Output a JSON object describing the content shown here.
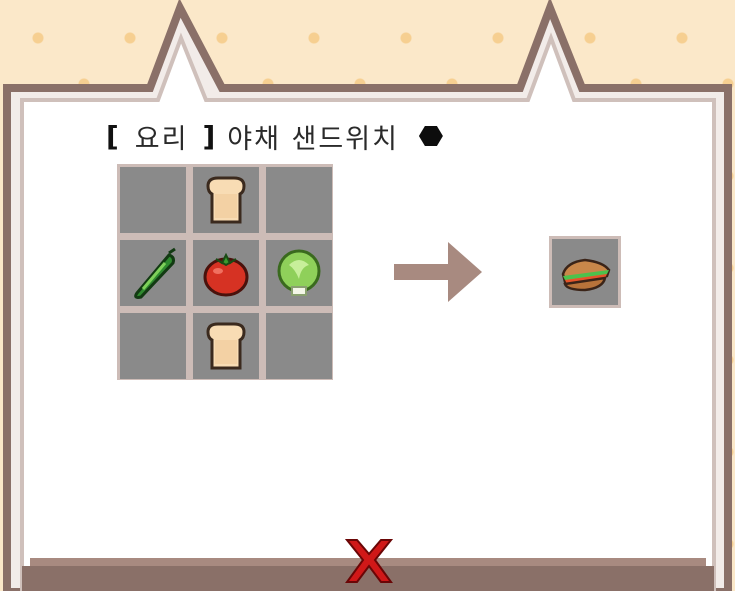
{
  "recipe": {
    "bracket_open": "[",
    "category": "요리",
    "bracket_close": "]",
    "name": "야채 샌드위치"
  },
  "ingredients": [
    {
      "slot": 1,
      "item": "empty"
    },
    {
      "slot": 2,
      "item": "bread-slice"
    },
    {
      "slot": 3,
      "item": "empty"
    },
    {
      "slot": 4,
      "item": "cucumber"
    },
    {
      "slot": 5,
      "item": "tomato"
    },
    {
      "slot": 6,
      "item": "lettuce"
    },
    {
      "slot": 7,
      "item": "empty"
    },
    {
      "slot": 8,
      "item": "bread-slice"
    },
    {
      "slot": 9,
      "item": "empty"
    }
  ],
  "result": {
    "item": "vegetable-sandwich"
  },
  "icons": {
    "arrow": "right-arrow-icon",
    "close": "close-x-icon",
    "status": "black-hexagon-icon"
  },
  "colors": {
    "background": "#fbe8c9",
    "frame_border": "#8a7068",
    "panel": "#ffffff",
    "slot": "#8a8a8a",
    "slot_border": "#cdbcb7",
    "arrow": "#a88a80",
    "close": "#d01818"
  }
}
